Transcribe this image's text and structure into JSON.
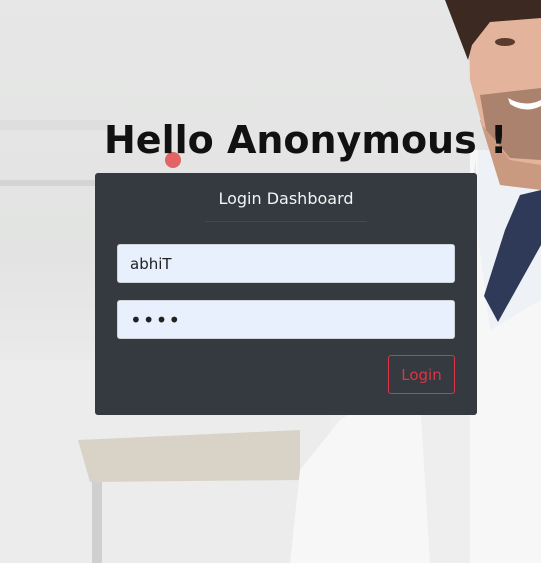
{
  "header": {
    "greeting": "Hello Anonymous !"
  },
  "login_card": {
    "title": "Login Dashboard",
    "username_value": "abhiT",
    "password_value": "1234",
    "login_label": "Login"
  },
  "colors": {
    "card_bg": "#343a40",
    "input_bg": "#e8f0fe",
    "login_accent": "#dc3545"
  }
}
